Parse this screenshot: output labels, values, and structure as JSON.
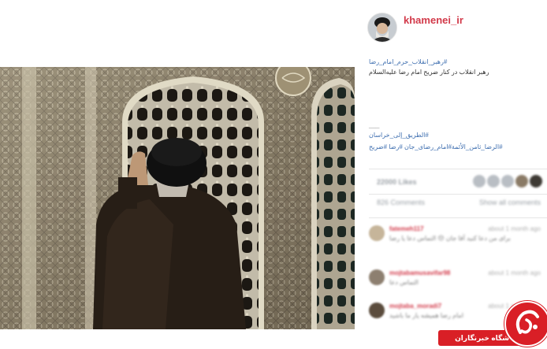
{
  "post": {
    "username": "khamenei_ir",
    "caption_hashtag_1": "#رهبر_انقلاب_حرم_امام_رضا",
    "caption_text": "رهبر انقلاب در کنار ضریح امام رضا علیه‌السلام",
    "caption_dash": "___",
    "caption_hashtag_2": "#الطريق_إلى_خراسان",
    "caption_hashtag_3": "#الرضا_ثامن_الأئمة#امام_رضای_جان #رضا #ضریح"
  },
  "engagement": {
    "likes_text": "22000 Likes",
    "comments_text": "826 Comments",
    "show_all": "Show all comments"
  },
  "comments": [
    {
      "name": "fatemeh117",
      "time": "about 1 month ago",
      "text": "برای من دعا کنید آقا جان 😔 التماس دعا یا رضا"
    },
    {
      "name": "mojtabamusavifar98",
      "time": "about 1 month ago",
      "text": "التماس دعا"
    },
    {
      "name": "mojtaba_moradi7",
      "time": "about 1 month ago",
      "text": "امام رضا همیشه یار ما باشید"
    }
  ],
  "watermark": {
    "text": "باشگاه خبرنگاران"
  },
  "icons": {
    "avatar": "profile-photo",
    "watermark_logo": "yjc-logo"
  },
  "colors": {
    "username": "#d23a4a",
    "hashtag": "#3f6fb0",
    "watermark": "#d91f26"
  }
}
